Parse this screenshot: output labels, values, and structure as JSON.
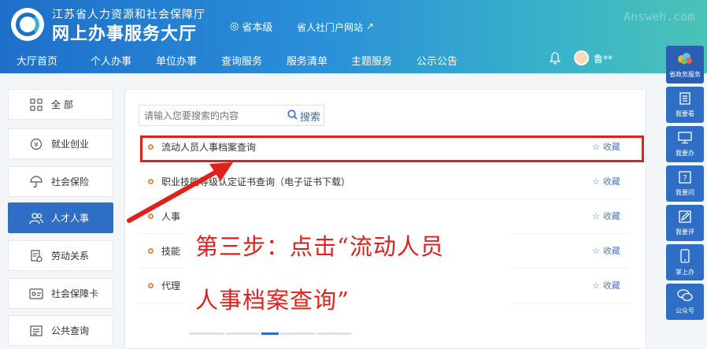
{
  "header": {
    "org_name": "江苏省人力资源和社会保障厅",
    "site_name": "网上办事服务大厅",
    "region": "省本级",
    "portal_link": "省人社门户网站",
    "watermark": "Answeh.com",
    "username": "鲁**"
  },
  "nav": {
    "items": [
      {
        "label": "大厅首页"
      },
      {
        "label": "个人办事"
      },
      {
        "label": "单位办事"
      },
      {
        "label": "查询服务",
        "active": true
      },
      {
        "label": "服务清单"
      },
      {
        "label": "主题服务"
      },
      {
        "label": "公示公告"
      }
    ]
  },
  "sidebar": {
    "items": [
      {
        "label": "全 部",
        "icon": "grid-icon"
      },
      {
        "label": "就业创业",
        "icon": "coin-icon"
      },
      {
        "label": "社会保险",
        "icon": "umbrella-icon"
      },
      {
        "label": "人才人事",
        "icon": "people-icon",
        "active": true
      },
      {
        "label": "劳动关系",
        "icon": "document-icon"
      },
      {
        "label": "社会保障卡",
        "icon": "card-icon"
      },
      {
        "label": "公共查询",
        "icon": "list-icon"
      }
    ]
  },
  "search": {
    "placeholder": "请输入您要搜索的内容",
    "button_label": "搜索"
  },
  "services": {
    "fav_label": "收藏",
    "items": [
      {
        "title": "流动人员人事档案查询"
      },
      {
        "title": "职业技能等级认定证书查询（电子证书下载）"
      },
      {
        "title": "人事"
      },
      {
        "title": "技能"
      },
      {
        "title": "代理"
      }
    ]
  },
  "float_bar": {
    "items": [
      {
        "label": "省政务服务",
        "icon": "cloud-icon"
      },
      {
        "label": "我要看",
        "icon": "book-icon"
      },
      {
        "label": "我要办",
        "icon": "monitor-icon"
      },
      {
        "label": "我要问",
        "icon": "question-icon"
      },
      {
        "label": "我要评",
        "icon": "edit-icon"
      },
      {
        "label": "掌上办",
        "icon": "phone-icon"
      },
      {
        "label": "公众号",
        "icon": "wechat-icon"
      }
    ]
  },
  "annotation": {
    "line1": "第三步：点击“流动人员",
    "line2": "人事档案查询”",
    "color": "#e0201b"
  },
  "colors": {
    "primary": "#2e6ec5",
    "bullet": "#e78a3a"
  }
}
